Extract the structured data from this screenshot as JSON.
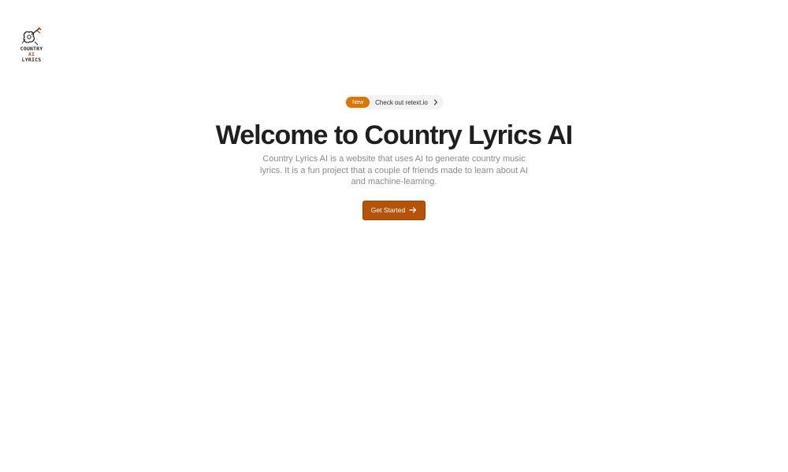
{
  "logo": {
    "line1": "COUNTRY",
    "line2": "AI",
    "line3": "LYRICS",
    "accent_color": "#c2410c",
    "icon": "guitar-icon"
  },
  "announcement": {
    "badge": "New",
    "text": "Check out retext.io",
    "icon": "chevron-right-icon",
    "badge_color": "#d97706"
  },
  "hero": {
    "title": "Welcome to Country Lyrics AI",
    "description": "Country Lyrics AI is a website that uses AI to generate country music lyrics. It is a fun project that a couple of friends made to learn about AI and machine-learning."
  },
  "cta": {
    "label": "Get Started",
    "icon": "arrow-right-icon",
    "color": "#b45309"
  }
}
